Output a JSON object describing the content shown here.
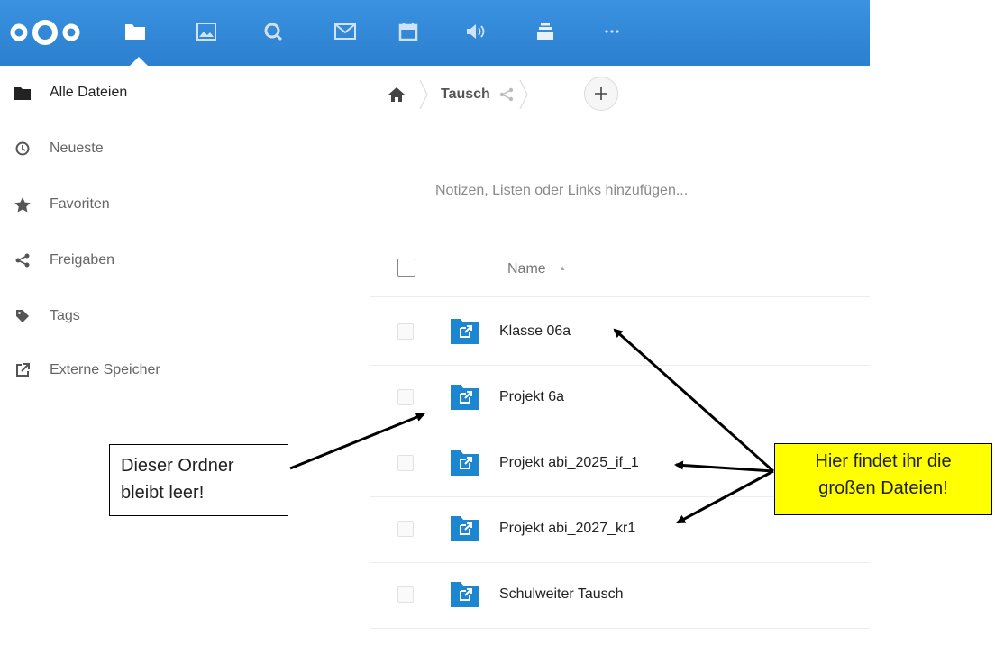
{
  "topbar": {
    "colors": {
      "bar": "#2b80cf"
    },
    "apps": [
      {
        "icon": "folder-icon",
        "name": "files"
      },
      {
        "icon": "image-icon",
        "name": "photos"
      },
      {
        "icon": "search-icon",
        "name": "activity"
      },
      {
        "icon": "mail-icon",
        "name": "mail"
      },
      {
        "icon": "calendar-icon",
        "name": "calendar"
      },
      {
        "icon": "speaker-icon",
        "name": "audio"
      },
      {
        "icon": "deck-icon",
        "name": "deck"
      },
      {
        "icon": "more-icon",
        "name": "more"
      }
    ]
  },
  "sidebar": {
    "items": [
      {
        "label": "Alle Dateien",
        "icon": "folder-icon"
      },
      {
        "label": "Neueste",
        "icon": "clock-icon"
      },
      {
        "label": "Favoriten",
        "icon": "star-icon"
      },
      {
        "label": "Freigaben",
        "icon": "share-icon"
      },
      {
        "label": "Tags",
        "icon": "tag-icon"
      },
      {
        "label": "Externe Speicher",
        "icon": "external-icon"
      }
    ]
  },
  "breadcrumb": {
    "current": "Tausch"
  },
  "notes_placeholder": "Notizen, Listen oder Links hinzufügen...",
  "table": {
    "header": {
      "name": "Name",
      "sort_indicator": "▲"
    },
    "rows": [
      {
        "name": "Klasse 06a"
      },
      {
        "name": "Projekt 6a"
      },
      {
        "name": "Projekt abi_2025_if_1"
      },
      {
        "name": "Projekt abi_2027_kr1"
      },
      {
        "name": "Schulweiter Tausch"
      }
    ]
  },
  "callouts": {
    "left": [
      "Dieser Ordner",
      "bleibt leer!"
    ],
    "right": [
      "Hier findet ihr die",
      "großen Dateien!"
    ]
  }
}
